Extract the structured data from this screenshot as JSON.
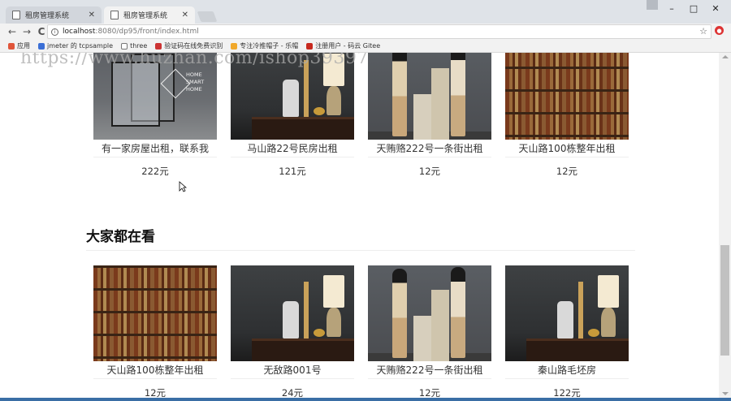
{
  "tabs": [
    {
      "title": "租房管理系统",
      "active": false
    },
    {
      "title": "租房管理系统",
      "active": true
    }
  ],
  "window_controls": {
    "minimize": "–",
    "maximize": "□",
    "close": "✕"
  },
  "toolbar": {
    "back": "←",
    "forward": "→",
    "reload": "C",
    "url_host": "localhost",
    "url_path": ":8080/dp95/front/index.html",
    "star": "☆"
  },
  "bookmarks": [
    {
      "label": "应用",
      "color": "#e0553a"
    },
    {
      "label": "jmeter 的 tcpsample",
      "color": "#3b6fd6"
    },
    {
      "label": "three",
      "color": "#ffffff"
    },
    {
      "label": "验证码在线免费识别",
      "color": "#c33"
    },
    {
      "label": "专注冷推帽子 - 乐帽",
      "color": "#f1a82a"
    },
    {
      "label": "注册用户 - 码云 Gitee",
      "color": "#c7291e"
    }
  ],
  "watermark": "https://www.huzhan.com/ishop39397",
  "top_listings": [
    {
      "title": "有一家房屋出租，联系我",
      "price": "222元",
      "image": "smart-home-booth"
    },
    {
      "title": "马山路22号民房出租",
      "price": "121元",
      "image": "lamp-interior"
    },
    {
      "title": "天贿赂222号一条街出租",
      "price": "12元",
      "image": "fashion-models"
    },
    {
      "title": "天山路100栋整年出租",
      "price": "12元",
      "image": "bookshelf"
    }
  ],
  "smart_home": {
    "line1": "HOME",
    "line2": "SMART",
    "line3": "HOME"
  },
  "section": {
    "title": "大家都在看"
  },
  "popular_listings": [
    {
      "title": "天山路100栋整年出租",
      "price": "12元",
      "image": "bookshelf"
    },
    {
      "title": "无敌路001号",
      "price": "24元",
      "image": "lamp-interior"
    },
    {
      "title": "天贿赂222号一条街出租",
      "price": "12元",
      "image": "fashion-models"
    },
    {
      "title": "秦山路毛坯房",
      "price": "122元",
      "image": "lamp-interior"
    }
  ]
}
